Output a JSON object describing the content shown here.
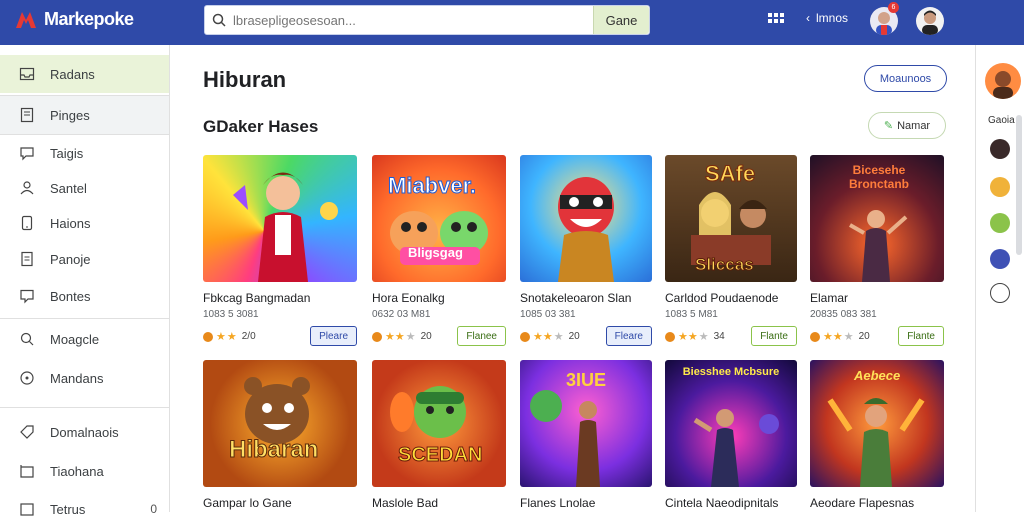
{
  "app": {
    "name": "Markepoke"
  },
  "search": {
    "placeholder": "lbrasepligeosesoan...",
    "button_label": "Gane"
  },
  "header": {
    "back_label": "lmnos",
    "notif_count": "6"
  },
  "sidebar": {
    "items": [
      {
        "label": "Radans",
        "icon": "inbox-icon"
      },
      {
        "label": "Pinges",
        "icon": "document-icon"
      },
      {
        "label": "Taigis",
        "icon": "chat-icon"
      },
      {
        "label": "Santel",
        "icon": "user-icon"
      },
      {
        "label": "Haions",
        "icon": "tablet-icon"
      },
      {
        "label": "Panoje",
        "icon": "page-icon"
      },
      {
        "label": "Bontes",
        "icon": "message-icon"
      },
      {
        "label": "Moagcle",
        "icon": "search-icon"
      },
      {
        "label": "Mandans",
        "icon": "circle-icon"
      },
      {
        "label": "Domalnaois",
        "icon": "tag-icon"
      },
      {
        "label": "Tiaohana",
        "icon": "box-icon"
      },
      {
        "label": "Tetrus",
        "icon": "card-icon",
        "count": "0"
      }
    ]
  },
  "main": {
    "title": "Hiburan",
    "section_title": "GDaker Hases",
    "manage_label": "Moaunoos",
    "filter_label": "Namar",
    "cards": [
      {
        "title": "Fbkcag Bangmadan",
        "meta": "1083 5 3081",
        "rating": "2/0",
        "button": "Pleare",
        "button_style": "blue"
      },
      {
        "title": "Hora Eonalkg",
        "meta": "0632 03 M81",
        "rating": "20",
        "button": "Flanee",
        "button_style": "green"
      },
      {
        "title": "Snotakeleoaron Slan",
        "meta": "1085 03 381",
        "rating": "20",
        "button": "Fleare",
        "button_style": "blue"
      },
      {
        "title": "Carldod Poudaenode",
        "meta": "1083 5 M81",
        "rating": "34",
        "button": "Flante",
        "button_style": "green"
      },
      {
        "title": "Elamar",
        "meta": "20835 083 381",
        "rating": "20",
        "button": "Flante",
        "button_style": "green"
      },
      {
        "title": "Gampar lo Gane",
        "meta": "",
        "rating": "",
        "button": "",
        "button_style": ""
      },
      {
        "title": "Maslole Bad",
        "meta": "",
        "rating": "",
        "button": "",
        "button_style": ""
      },
      {
        "title": "Flanes Lnolae",
        "meta": "",
        "rating": "",
        "button": "",
        "button_style": ""
      },
      {
        "title": "Cintela Naeodipnitals",
        "meta": "",
        "rating": "",
        "button": "",
        "button_style": ""
      },
      {
        "title": "Aeodare Flapesnas",
        "meta": "",
        "rating": "",
        "button": "",
        "button_style": ""
      }
    ],
    "thumb_text": [
      "",
      "Miabver.",
      "",
      "SAfe",
      "Bicesehe Bronctanb",
      "Hibaran",
      "SCEDAN",
      "3IUE",
      "Biesshee Mcbsure",
      "Aebece"
    ],
    "thumb_sub": [
      "",
      "Bligsgag",
      "",
      "Sliccas",
      "",
      "",
      "",
      "",
      "",
      ""
    ]
  },
  "rail": {
    "label": "Gaoia"
  },
  "colors": {
    "topbar": "#2f4aa8",
    "active_nav": "#eaf3d9",
    "accent_green": "#8bc34a"
  }
}
